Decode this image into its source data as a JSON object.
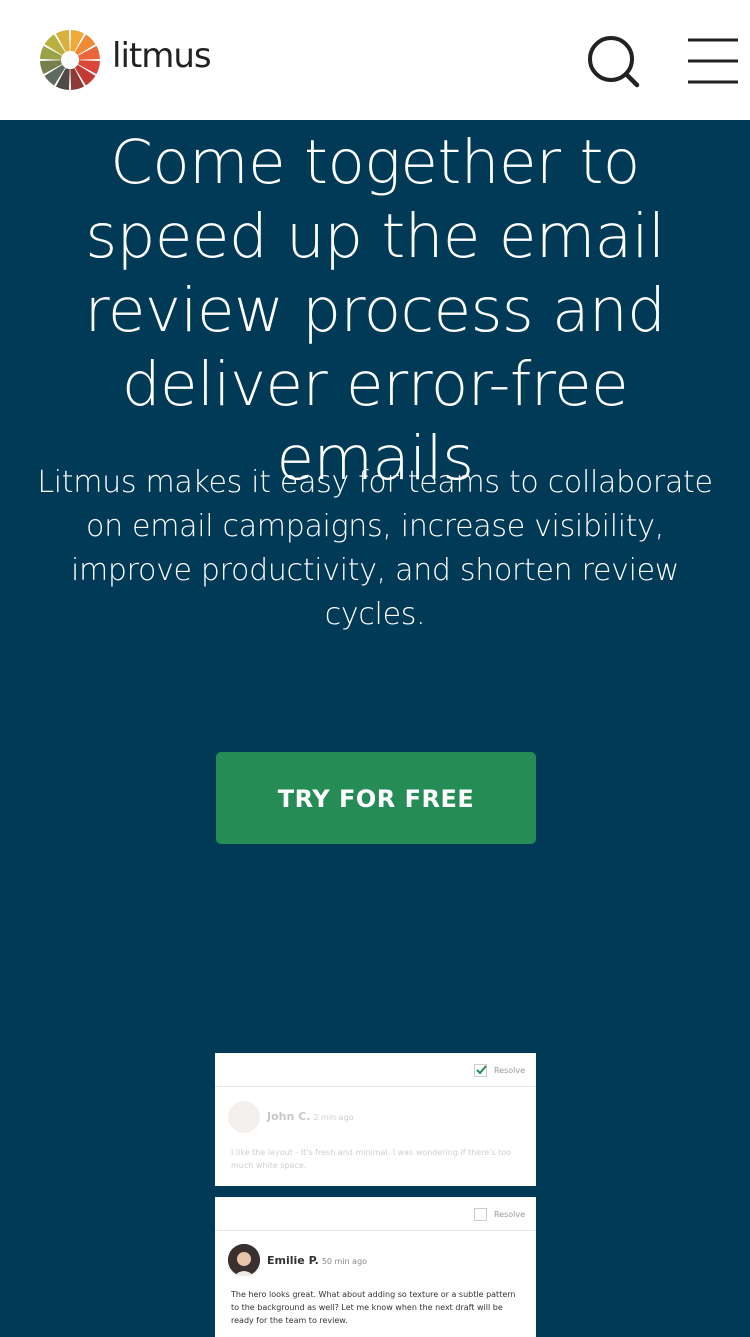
{
  "header": {
    "logo_text": "litmus",
    "search_icon": "search-icon",
    "menu_icon": "hamburger-menu-icon"
  },
  "hero": {
    "title": "Come together to speed up the email review process and deliver error-free emails",
    "subtitle": "Litmus makes it easy for teams to collaborate on email campaigns, increase visibility, improve productivity, and shorten review cycles.",
    "cta_label": "TRY FOR FREE"
  },
  "comments": [
    {
      "author": "John C.",
      "time": "2 min ago",
      "text": "I like the layout - It's fresh and minimal. I was wondering if there's too much white space.",
      "resolve_label": "Resolve",
      "resolved": true
    },
    {
      "author": "Emilie P.",
      "time": "50 min ago",
      "text": "The hero looks great. What about adding so texture or a subtle pattern to the background as well? Let me know when the next draft will be ready for the team to review.",
      "resolve_label": "Resolve",
      "resolved": false
    }
  ],
  "colors": {
    "hero_bg": "#003a57",
    "cta_bg": "#258c55",
    "header_bg": "#ffffff"
  }
}
